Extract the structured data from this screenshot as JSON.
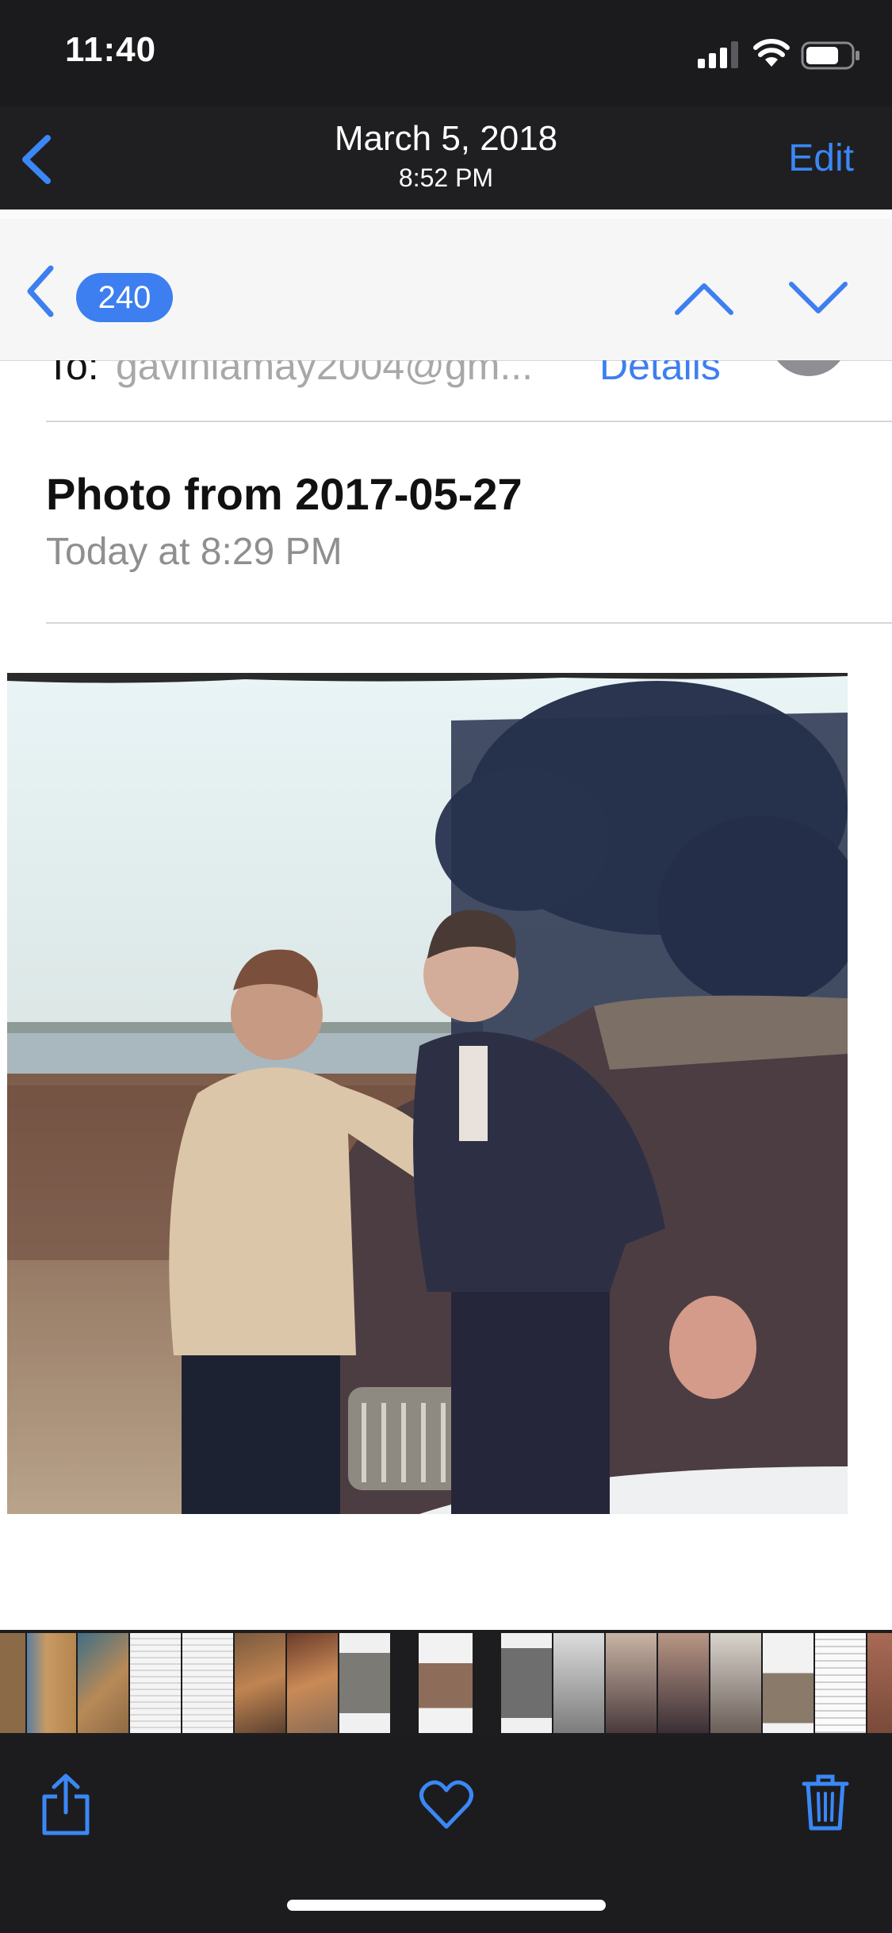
{
  "status_bar": {
    "time": "11:40",
    "signal_icon": "cellular-signal-icon",
    "wifi_icon": "wifi-icon",
    "battery_icon": "battery-icon"
  },
  "nav": {
    "back_icon": "chevron-left-icon",
    "title": "March 5, 2018",
    "subtitle": "8:52 PM",
    "edit_label": "Edit"
  },
  "mail": {
    "unread_count": "240",
    "to_label": "To:",
    "to_address": "gavinlamay2004@gm...",
    "details_label": "Details",
    "subject": "Photo from 2017-05-27",
    "date": "Today at 8:29 PM"
  },
  "toolbar": {
    "share_icon": "share-icon",
    "favorite_icon": "heart-icon",
    "delete_icon": "trash-icon"
  },
  "colors": {
    "accent": "#3b87f6",
    "badge": "#3d7ff0",
    "dark_bg": "#1c1c1e"
  }
}
